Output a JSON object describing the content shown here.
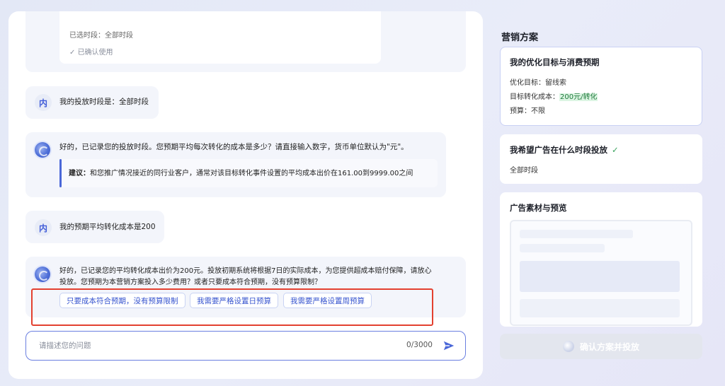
{
  "chat": {
    "top_card": {
      "selected_period": "已选时段：全部时段",
      "confirmed": "已确认使用"
    },
    "messages": [
      {
        "role": "user",
        "avatar": "内",
        "text": "我的投放时段是：全部时段"
      },
      {
        "role": "bot",
        "text": "好的，已记录您的投放时段。您预期平均每次转化的成本是多少？请直接输入数字，货币单位默认为\"元\"。",
        "suggestion_label": "建议：",
        "suggestion_text": "和您推广情况接近的同行业客户，通常对该目标转化事件设置的平均成本出价在161.00到9999.00之间"
      },
      {
        "role": "user",
        "avatar": "内",
        "text": "我的预期平均转化成本是200"
      },
      {
        "role": "bot",
        "text_line1": "好的，已记录您的平均转化成本出价为200元。投放初期系统将根据7日的实际成本，为您提供超成本赔付保障，请放心",
        "text_line2": "投放。您预期为本营销方案投入多少费用？或者只要成本符合预期，没有预算限制？",
        "options": [
          "只要成本符合预期，没有预算限制",
          "我需要严格设置日预算",
          "我需要严格设置周预算"
        ]
      }
    ]
  },
  "input": {
    "placeholder": "请描述您的问题",
    "counter": "0/3000"
  },
  "plan": {
    "title": "营销方案",
    "goal_card": {
      "title": "我的优化目标与消费预期",
      "opt_label": "优化目标：",
      "opt_value": "留线索",
      "cost_label": "目标转化成本：",
      "cost_value": "200元/转化",
      "budget_label": "预算：",
      "budget_value": "不限"
    },
    "period_card": {
      "title": "我希望广告在什么时段投放",
      "value": "全部时段"
    },
    "preview_card": {
      "title": "广告素材与预览"
    },
    "confirm_button": "确认方案并投放"
  },
  "colors": {
    "accent": "#3553cf",
    "highlight_border": "#e3402f",
    "success": "#3aa35f"
  }
}
